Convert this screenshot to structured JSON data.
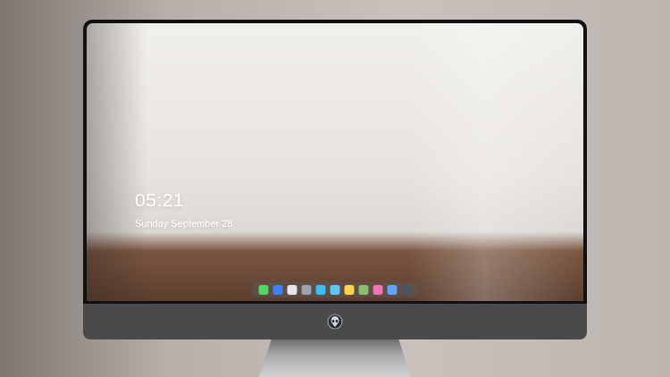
{
  "lock_screen": {
    "time": "05:21",
    "date": "Sunday September 28"
  },
  "dock": {
    "apps": [
      {
        "color": "#4cd964"
      },
      {
        "color": "#3b82f6"
      },
      {
        "color": "#e5e7eb"
      },
      {
        "color": "#9ca3af"
      },
      {
        "color": "#38bdf8"
      },
      {
        "color": "#5ac8fa"
      },
      {
        "color": "#fcd34d"
      },
      {
        "color": "#86c06c"
      },
      {
        "color": "#f472b6"
      },
      {
        "color": "#60a5fa"
      },
      {
        "color": "#4b5563"
      }
    ]
  }
}
